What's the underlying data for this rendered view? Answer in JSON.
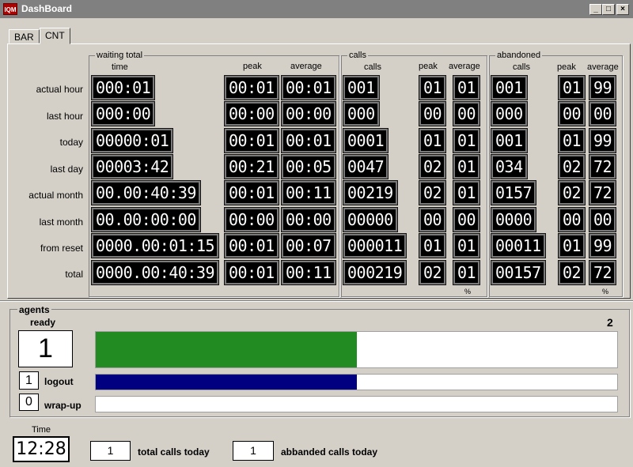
{
  "window": {
    "app_icon": "IQM",
    "title": "DashBoard",
    "min": "_",
    "max": "□",
    "close": "×"
  },
  "tabs": [
    {
      "label": "BAR"
    },
    {
      "label": "CNT"
    }
  ],
  "groups": {
    "waiting": "waiting total",
    "calls": "calls",
    "abandoned": "abandoned"
  },
  "headers": {
    "waiting": {
      "time": "time",
      "peak": "peak",
      "average": "average"
    },
    "calls": {
      "calls": "calls",
      "peak": "peak",
      "average": "average"
    },
    "abandoned": {
      "calls": "calls",
      "peak": "peak",
      "average": "average"
    }
  },
  "rows": [
    {
      "label": "actual hour",
      "w_time": "000:01",
      "w_peak": "00:01",
      "w_avg": "00:01",
      "c_calls": "001",
      "c_peak": "01",
      "c_avg": "01",
      "a_calls": "001",
      "a_peak": "01",
      "a_avg": "99"
    },
    {
      "label": "last hour",
      "w_time": "000:00",
      "w_peak": "00:00",
      "w_avg": "00:00",
      "c_calls": "000",
      "c_peak": "00",
      "c_avg": "00",
      "a_calls": "000",
      "a_peak": "00",
      "a_avg": "00"
    },
    {
      "label": "today",
      "w_time": "00000:01",
      "w_peak": "00:01",
      "w_avg": "00:01",
      "c_calls": "0001",
      "c_peak": "01",
      "c_avg": "01",
      "a_calls": "001",
      "a_peak": "01",
      "a_avg": "99"
    },
    {
      "label": "last day",
      "w_time": "00003:42",
      "w_peak": "00:21",
      "w_avg": "00:05",
      "c_calls": "0047",
      "c_peak": "02",
      "c_avg": "01",
      "a_calls": "034",
      "a_peak": "02",
      "a_avg": "72"
    },
    {
      "label": "actual month",
      "w_time": "00.00:40:39",
      "w_peak": "00:01",
      "w_avg": "00:11",
      "c_calls": "00219",
      "c_peak": "02",
      "c_avg": "01",
      "a_calls": "0157",
      "a_peak": "02",
      "a_avg": "72"
    },
    {
      "label": "last month",
      "w_time": "00.00:00:00",
      "w_peak": "00:00",
      "w_avg": "00:00",
      "c_calls": "00000",
      "c_peak": "00",
      "c_avg": "00",
      "a_calls": "0000",
      "a_peak": "00",
      "a_avg": "00"
    },
    {
      "label": "from reset",
      "w_time": "0000.00:01:15",
      "w_peak": "00:01",
      "w_avg": "00:07",
      "c_calls": "000011",
      "c_peak": "01",
      "c_avg": "01",
      "a_calls": "00011",
      "a_peak": "01",
      "a_avg": "99"
    },
    {
      "label": "total",
      "w_time": "0000.00:40:39",
      "w_peak": "00:01",
      "w_avg": "00:11",
      "c_calls": "000219",
      "c_peak": "02",
      "c_avg": "01",
      "a_calls": "00157",
      "a_peak": "02",
      "a_avg": "72"
    }
  ],
  "pct": {
    "calls": "%",
    "abandoned": "%"
  },
  "agents": {
    "title": "agents",
    "ready_label": "ready",
    "total": "2",
    "ready_value": "1",
    "ready_fraction": 0.5,
    "logout_value": "1",
    "logout_label": "logout",
    "logout_fraction": 0.5,
    "wrapup_value": "0",
    "wrapup_label": "wrap-up",
    "wrapup_fraction": 0
  },
  "colors": {
    "ready": "#228b22",
    "logout": "#000080"
  },
  "footer": {
    "time_label": "Time",
    "time_value": "12:28",
    "total_calls_value": "1",
    "total_calls_label": "total calls today",
    "abandoned_value": "1",
    "abandoned_label": "abbanded calls today"
  }
}
